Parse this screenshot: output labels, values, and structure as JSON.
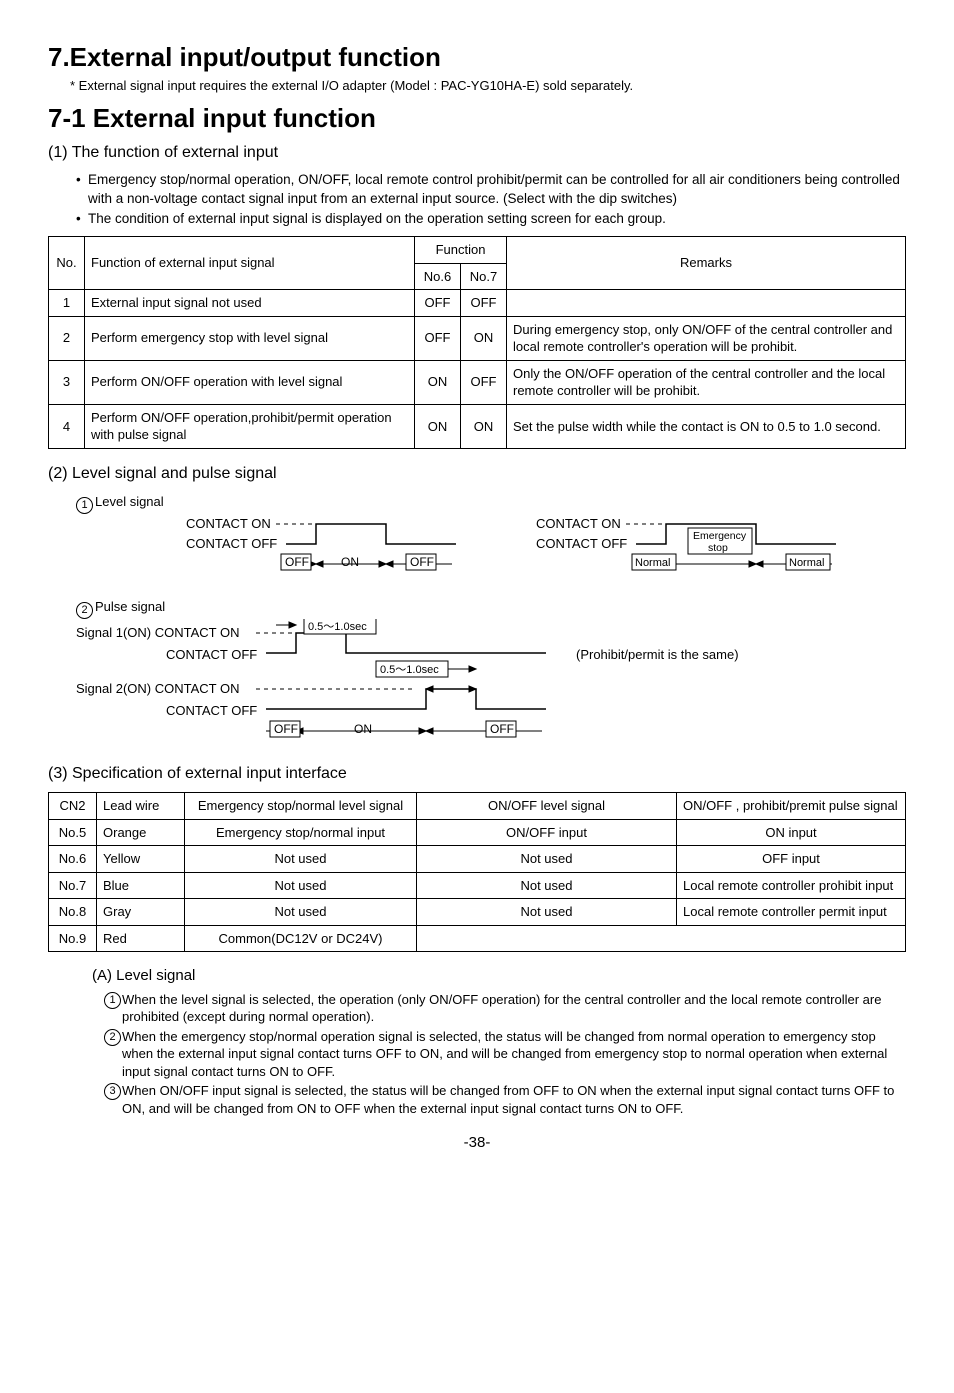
{
  "h1": "7.External input/output function",
  "footnote": "* External signal input requires the external I/O adapter (Model : PAC-YG10HA-E) sold separately.",
  "h2": "7-1 External input function",
  "sec1": {
    "title": "(1) The function of external input",
    "bullets": [
      "Emergency stop/normal operation, ON/OFF, local remote control prohibit/permit can be controlled for all air conditioners being controlled with a non-voltage contact signal input from an external input source. (Select with the dip switches)",
      "The condition of external input signal is displayed on the operation setting screen for each group."
    ],
    "thead": {
      "no": "No.",
      "fn": "Function of external input signal",
      "func": "Function",
      "n6": "No.6",
      "n7": "No.7",
      "rem": "Remarks"
    },
    "rows": [
      {
        "no": "1",
        "fn": "External input signal not used",
        "n6": "OFF",
        "n7": "OFF",
        "rem": ""
      },
      {
        "no": "2",
        "fn": "Perform emergency stop with level signal",
        "n6": "OFF",
        "n7": "ON",
        "rem": "During emergency stop, only ON/OFF of the central controller and local remote controller's operation will be prohibit."
      },
      {
        "no": "3",
        "fn": "Perform ON/OFF operation with level signal",
        "n6": "ON",
        "n7": "OFF",
        "rem": "Only the ON/OFF operation of the central controller and the local remote controller will be prohibit."
      },
      {
        "no": "4",
        "fn": "Perform ON/OFF operation,prohibit/permit operation with pulse signal",
        "n6": "ON",
        "n7": "ON",
        "rem": "Set the pulse width while the contact is ON to 0.5 to 1.0 second."
      }
    ]
  },
  "sec2": {
    "title": "(2) Level signal and pulse signal",
    "level_label": "Level signal",
    "pulse_label": "Pulse signal",
    "diagram": {
      "contact_on": "CONTACT ON",
      "contact_off": "CONTACT OFF",
      "off": "OFF",
      "on": "ON",
      "normal": "Normal",
      "emergency": "Emergency stop",
      "sig1": "Signal 1(ON) CONTACT ON",
      "sig2": "Signal 2(ON) CONTACT ON",
      "coff": "CONTACT OFF",
      "pw": "0.5～1.0sec",
      "prohibit_note": "(Prohibit/permit is the same)"
    }
  },
  "sec3": {
    "title": "(3) Specification of external input interface",
    "thead": {
      "cn2": "CN2",
      "lw": "Lead wire",
      "es": "Emergency stop/normal level signal",
      "oo": "ON/OFF level signal",
      "pp": "ON/OFF , prohibit/premit pulse signal"
    },
    "rows": [
      {
        "cn2": "No.5",
        "lw": "Orange",
        "es": "Emergency stop/normal input",
        "oo": "ON/OFF input",
        "pp": "ON input"
      },
      {
        "cn2": "No.6",
        "lw": "Yellow",
        "es": "Not used",
        "oo": "Not used",
        "pp": "OFF input"
      },
      {
        "cn2": "No.7",
        "lw": "Blue",
        "es": "Not used",
        "oo": "Not used",
        "pp": "Local remote controller prohibit input"
      },
      {
        "cn2": "No.8",
        "lw": "Gray",
        "es": "Not used",
        "oo": "Not used",
        "pp": "Local remote controller permit input"
      },
      {
        "cn2": "No.9",
        "lw": "Red",
        "es": "Common(DC12V or DC24V)",
        "oo": "",
        "pp": ""
      }
    ]
  },
  "secA": {
    "title": "(A) Level signal",
    "items": [
      "When the level signal is selected, the operation (only ON/OFF operation) for the central controller and the local remote controller are prohibited (except during normal operation).",
      "When the emergency stop/normal operation signal is selected, the status will be changed from normal operation to emergency stop when the external input signal contact turns OFF to ON, and will be changed from emergency stop to normal operation when external input signal contact turns ON to OFF.",
      "When ON/OFF input signal is selected, the status will be changed from OFF to ON when the external input signal contact turns OFF to ON, and will be changed from ON to OFF when the external input signal contact turns ON to OFF."
    ]
  },
  "pagenum": "-38-"
}
